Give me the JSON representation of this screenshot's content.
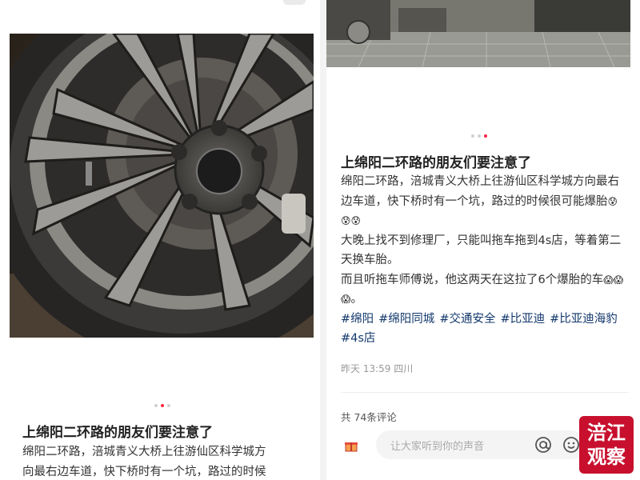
{
  "left": {
    "title": "上绵阳二环路的朋友们要注意了",
    "body_line1": "绵阳二环路，涪城青义大桥上往游仙区科学城方",
    "body_line2": "向最右边车道，快下桥时有一个坑，路过的时候"
  },
  "right": {
    "title": "上绵阳二环路的朋友们要注意了",
    "para1": "绵阳二环路，涪城青义大桥上往游仙区科学城方向最右边车道，快下桥时有一个坑，路过的时候很可能爆胎",
    "para1_emoji": "😰😰😰",
    "para2": "大晚上找不到修理厂，只能叫拖车拖到4s店，等着第二天换车胎。",
    "para3": "而且听拖车师傅说，他这两天在这拉了6个爆胎的车",
    "para3_emoji": "😱😱😱",
    "para3_end": "。",
    "tags": [
      "#绵阳",
      "#绵阳同城",
      "#交通安全",
      "#比亚迪",
      "#比亚迪海豹",
      "#4s店"
    ],
    "meta": "昨天 13:59 四川",
    "comments": "共 74条评论",
    "input_placeholder": "让大家听到你的声音"
  },
  "watermark": {
    "line1": "涪江",
    "line2": "观察"
  },
  "colors": {
    "accent": "#ff2442",
    "tag": "#13386c",
    "watermark_bg": "#c8102e"
  },
  "icons": [
    "gift-icon",
    "at-icon",
    "emoji-icon",
    "image-icon"
  ]
}
